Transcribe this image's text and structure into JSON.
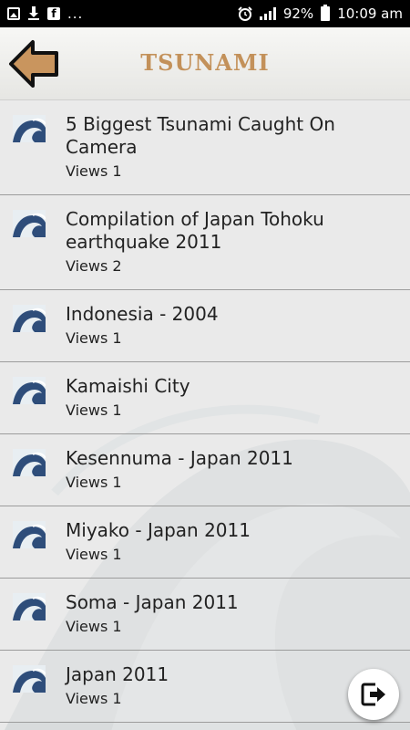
{
  "status_bar": {
    "dots": "...",
    "battery": "92%",
    "time": "10:09 am",
    "icons": [
      "image-icon",
      "download-icon",
      "facebook-icon",
      "alarm-icon",
      "signal-icon",
      "battery-icon"
    ]
  },
  "header": {
    "title": "TSUNAMI",
    "back_icon": "back-arrow-icon",
    "title_color": "#c3915a"
  },
  "videos": [
    {
      "title": "5 Biggest Tsunami Caught On Camera",
      "views": "Views 1"
    },
    {
      "title": "Compilation of Japan Tohoku earthquake 2011",
      "views": "Views 2"
    },
    {
      "title": "Indonesia - 2004",
      "views": "Views 1"
    },
    {
      "title": "Kamaishi City",
      "views": "Views 1"
    },
    {
      "title": "Kesennuma - Japan 2011",
      "views": "Views 1"
    },
    {
      "title": "Miyako - Japan 2011",
      "views": "Views 1"
    },
    {
      "title": "Soma - Japan 2011",
      "views": "Views 1"
    },
    {
      "title": "Japan 2011",
      "views": "Views 1"
    }
  ],
  "fab": {
    "icon": "exit-icon"
  }
}
